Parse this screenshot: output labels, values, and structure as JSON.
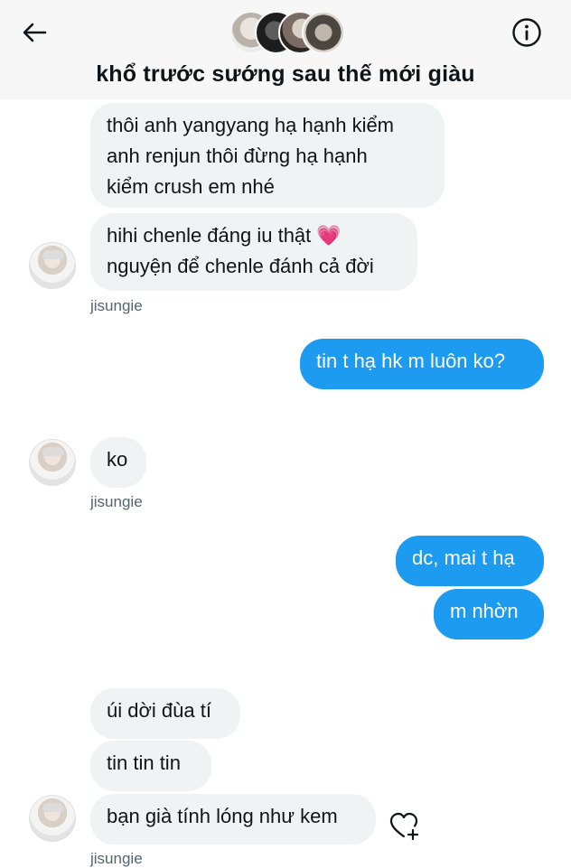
{
  "header": {
    "title": "khổ trước sướng sau thế mới giàu",
    "back_icon": "arrow-left-icon",
    "info_icon": "info-icon",
    "background": "#f7f7f7"
  },
  "colors": {
    "outgoing_bubble": "#1d9bf0",
    "incoming_bubble": "#eff3f4",
    "text": "#0f1419",
    "secondary_text": "#536471"
  },
  "messages": [
    {
      "direction": "in",
      "text": "thôi anh yangyang hạ hạnh kiểm\nanh renjun thôi đừng hạ hạnh\nkiểm crush em nhé"
    },
    {
      "direction": "in",
      "text": "hihi chenle đáng iu thật 💗\nnguyện để chenle đánh cả đời",
      "sender": "jisungie"
    },
    {
      "direction": "out",
      "text": "tin t hạ hk m luôn ko?"
    },
    {
      "direction": "in",
      "text": "ko",
      "sender": "jisungie"
    },
    {
      "direction": "out",
      "text": "dc, mai t hạ"
    },
    {
      "direction": "out",
      "text": "m nhờn"
    },
    {
      "direction": "in",
      "text": "úi dời đùa tí"
    },
    {
      "direction": "in",
      "text": "tin tin tin"
    },
    {
      "direction": "in",
      "text": "bạn già tính lóng như kem",
      "sender": "jisungie"
    }
  ],
  "reaction_icon": "heart-plus-icon"
}
